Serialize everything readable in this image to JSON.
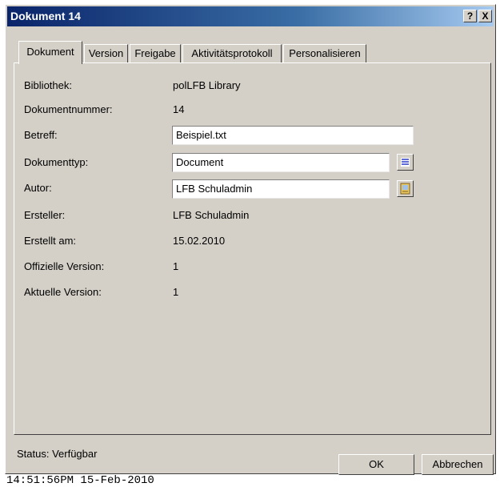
{
  "window": {
    "title": "Dokument 14",
    "help_label": "?",
    "close_label": "X"
  },
  "tabs": [
    {
      "label": "Dokument",
      "active": true
    },
    {
      "label": "Version",
      "active": false
    },
    {
      "label": "Freigabe",
      "active": false
    },
    {
      "label": "Aktivitätsprotokoll",
      "active": false
    },
    {
      "label": "Personalisieren",
      "active": false
    }
  ],
  "fields": {
    "bibliothek": {
      "label": "Bibliothek:",
      "value": "polLFB Library"
    },
    "dokumentnummer": {
      "label": "Dokumentnummer:",
      "value": "14"
    },
    "betreff": {
      "label": "Betreff:",
      "value": "Beispiel.txt"
    },
    "dokumenttyp": {
      "label": "Dokumenttyp:",
      "value": "Document"
    },
    "autor": {
      "label": "Autor:",
      "value": "LFB Schuladmin"
    },
    "ersteller": {
      "label": "Ersteller:",
      "value": "LFB Schuladmin"
    },
    "erstellt_am": {
      "label": "Erstellt am:",
      "value": "15.02.2010"
    },
    "offizielle_version": {
      "label": "Offizielle Version:",
      "value": "1"
    },
    "aktuelle_version": {
      "label": "Aktuelle Version:",
      "value": "1"
    }
  },
  "status": {
    "text": "Status: Verfügbar"
  },
  "buttons": {
    "ok": "OK",
    "cancel": "Abbrechen"
  },
  "timestamp": "14:51:56PM 15-Feb-2010",
  "colors": {
    "face": "#d4d0c8",
    "title_start": "#0a246a",
    "title_end": "#a6caf0",
    "list_icon": "#2a3ac8"
  }
}
